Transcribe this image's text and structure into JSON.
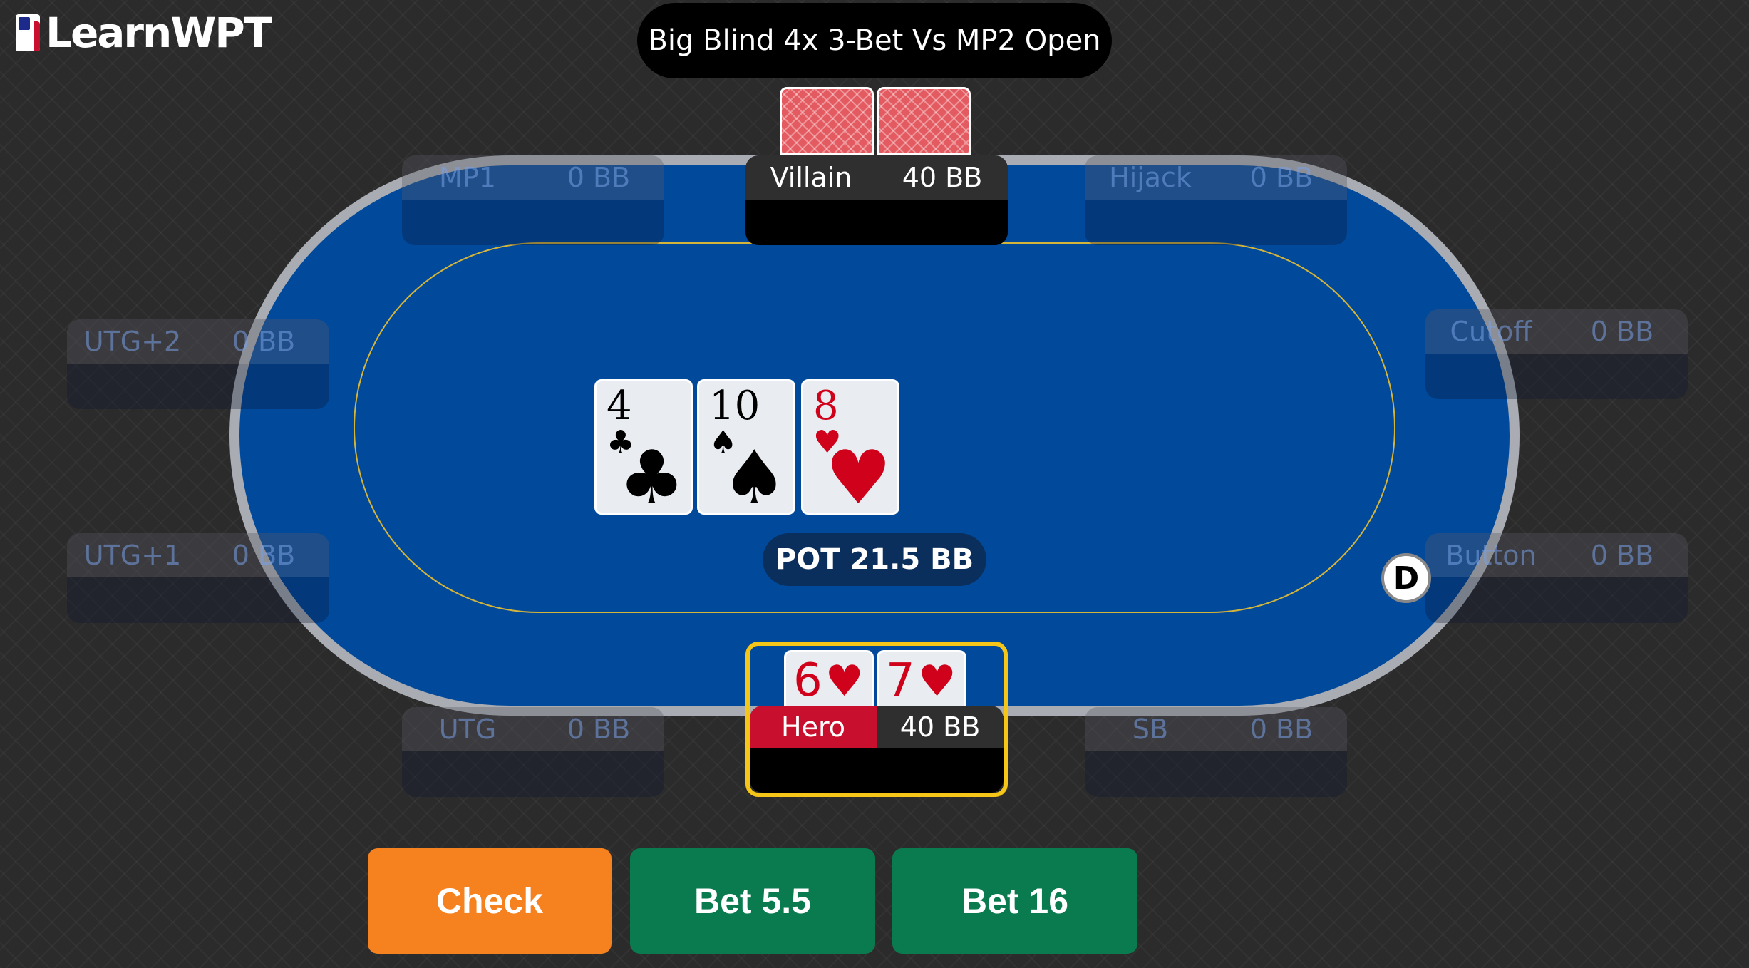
{
  "logo": {
    "text": "LearnWPT"
  },
  "scenario_title": "Big Blind 4x 3-Bet Vs MP2 Open",
  "seats": {
    "mp1": {
      "name": "MP1",
      "stack": "0 BB"
    },
    "villain": {
      "name": "Villain",
      "stack": "40 BB"
    },
    "hijack": {
      "name": "Hijack",
      "stack": "0 BB"
    },
    "utg2": {
      "name": "UTG+2",
      "stack": "0 BB"
    },
    "cutoff": {
      "name": "Cutoff",
      "stack": "0 BB"
    },
    "utg1": {
      "name": "UTG+1",
      "stack": "0 BB"
    },
    "button": {
      "name": "Button",
      "stack": "0 BB"
    },
    "utg": {
      "name": "UTG",
      "stack": "0 BB"
    },
    "hero": {
      "name": "Hero",
      "stack": "40 BB"
    },
    "sb": {
      "name": "SB",
      "stack": "0 BB"
    }
  },
  "board": [
    {
      "rank": "4",
      "suit": "♣",
      "color": "#000000"
    },
    {
      "rank": "10",
      "suit": "♠",
      "color": "#000000"
    },
    {
      "rank": "8",
      "suit": "♥",
      "color": "#d0021b"
    }
  ],
  "hero_cards": [
    {
      "rank": "6",
      "suit": "♥"
    },
    {
      "rank": "7",
      "suit": "♥"
    }
  ],
  "pot": "POT 21.5 BB",
  "dealer_button": "D",
  "actions": {
    "check": "Check",
    "bet_small": "Bet 5.5",
    "bet_large": "Bet 16"
  },
  "colors": {
    "felt": "#00499b",
    "rail": "#a9acb2",
    "check_button": "#f6821f",
    "bet_button": "#0a7a4f",
    "hero_highlight": "#f5c518",
    "hero_label": "#c8102e"
  }
}
